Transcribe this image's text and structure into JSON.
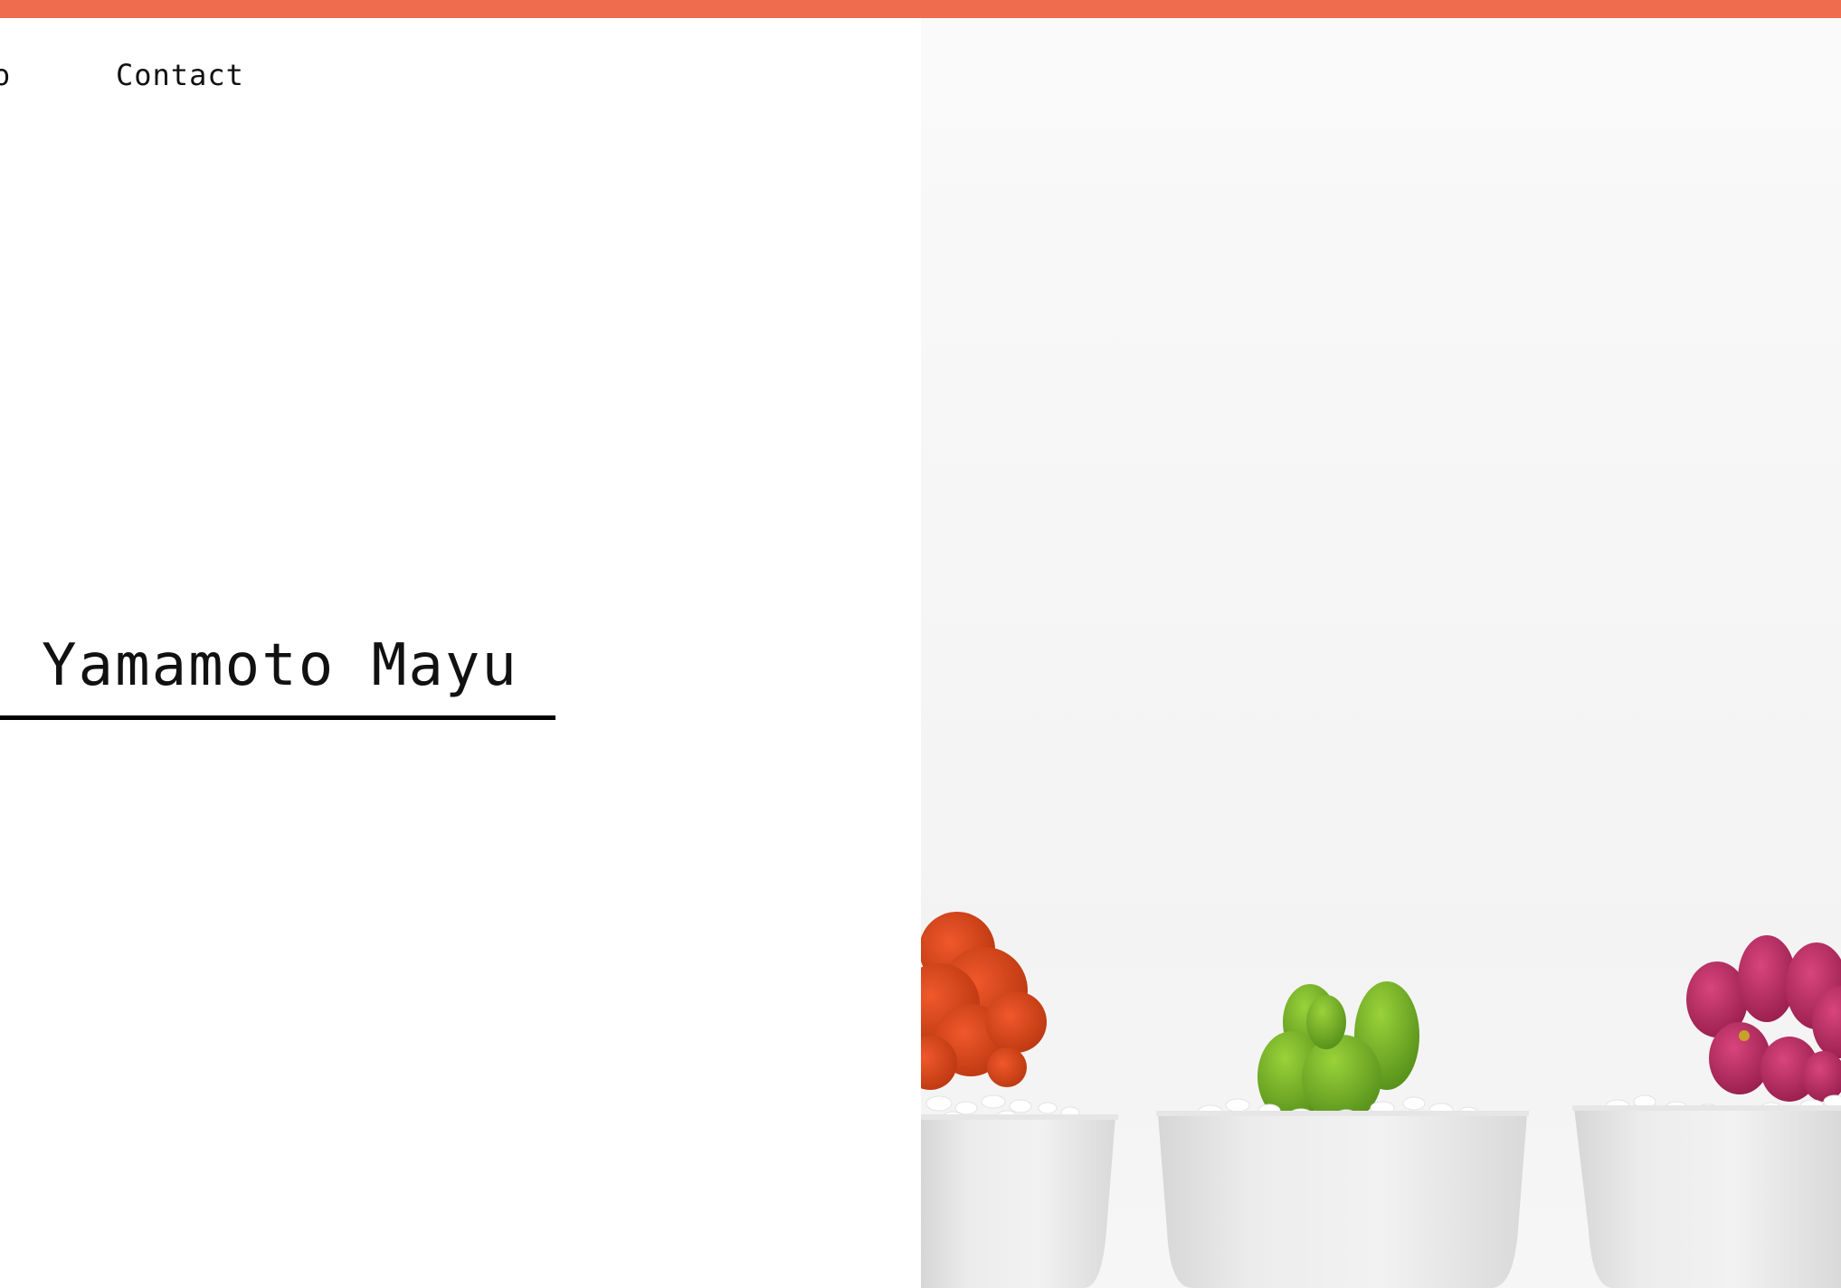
{
  "colors": {
    "accent": "#F06C4F",
    "text": "#111111",
    "background": "#FFFFFF",
    "image_backdrop": "#F5F5F5"
  },
  "nav": {
    "items": [
      {
        "label": "o",
        "state": "cut off at left edge"
      },
      {
        "label": "Contact"
      }
    ]
  },
  "hero": {
    "title": "Yamamoto Mayu",
    "image": "three-potted-cacti-photo"
  }
}
